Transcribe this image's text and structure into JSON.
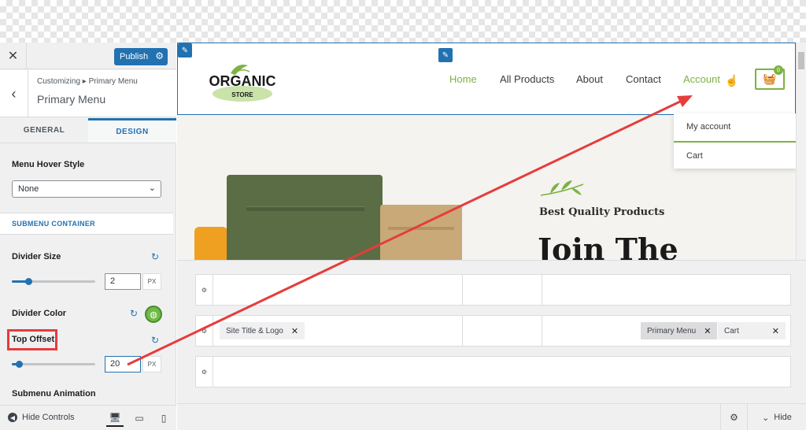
{
  "sidebar": {
    "close_icon": "✕",
    "publish_label": "Publish",
    "breadcrumb": "Customizing ▸ Primary Menu",
    "section_title": "Primary Menu",
    "tabs": [
      {
        "label": "GENERAL",
        "active": false
      },
      {
        "label": "DESIGN",
        "active": true
      }
    ],
    "menu_hover_style": {
      "label": "Menu Hover Style",
      "value": "None"
    },
    "submenu_container_heading": "SUBMENU CONTAINER",
    "divider_size": {
      "label": "Divider Size",
      "value": "2",
      "unit": "PX"
    },
    "divider_color": {
      "label": "Divider Color",
      "color": "#6dbb45"
    },
    "top_offset": {
      "label": "Top Offset",
      "value": "20",
      "unit": "PX"
    },
    "submenu_animation_label": "Submenu Animation",
    "hide_controls_label": "Hide Controls",
    "accent_color": "#2271b1"
  },
  "preview": {
    "logo": {
      "line1": "ORGANIC",
      "line2": "STORE"
    },
    "nav": [
      {
        "label": "Home",
        "active": true
      },
      {
        "label": "All Products",
        "active": false
      },
      {
        "label": "About",
        "active": false
      },
      {
        "label": "Contact",
        "active": false
      },
      {
        "label": "Account",
        "active": true
      }
    ],
    "cart_count": "0",
    "submenu": [
      "My account",
      "Cart"
    ],
    "hero": {
      "tagline": "Best Quality Products",
      "heading": "Join The"
    },
    "brand_color": "#7cb342"
  },
  "builder": {
    "rows": [
      {
        "chips": []
      },
      {
        "chips": [
          "Site Title & Logo",
          "Primary Menu",
          "Cart"
        ]
      },
      {
        "chips": []
      }
    ],
    "hide_label": "Hide"
  }
}
